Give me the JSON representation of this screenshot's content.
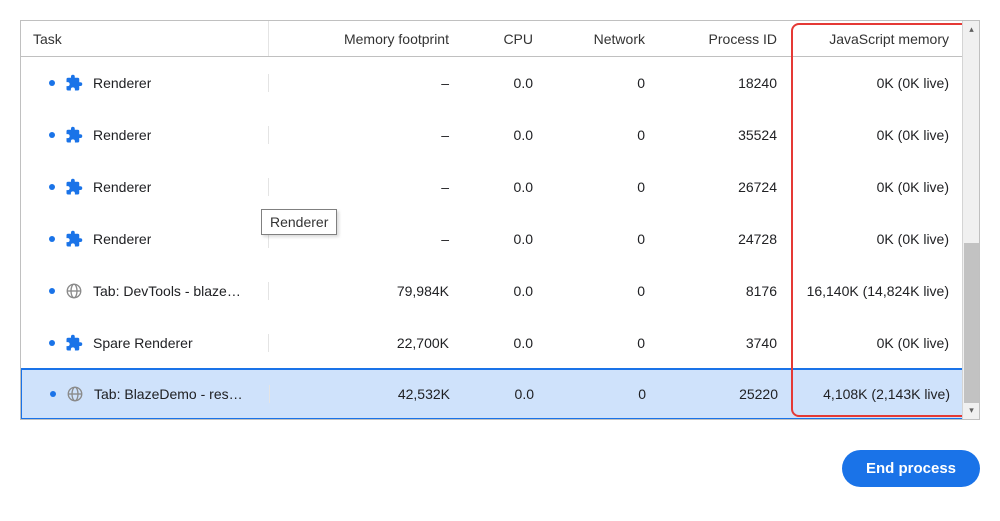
{
  "header": {
    "task": "Task",
    "mem": "Memory footprint",
    "cpu": "CPU",
    "net": "Network",
    "pid": "Process ID",
    "js": "JavaScript memory"
  },
  "tooltip": "Renderer",
  "endButton": "End process",
  "rows": [
    {
      "icon": "ext",
      "name": "Renderer",
      "mem": "–",
      "cpu": "0.0",
      "net": "0",
      "pid": "18240",
      "js": "0K (0K live)"
    },
    {
      "icon": "ext",
      "name": "Renderer",
      "mem": "–",
      "cpu": "0.0",
      "net": "0",
      "pid": "35524",
      "js": "0K (0K live)"
    },
    {
      "icon": "ext",
      "name": "Renderer",
      "mem": "–",
      "cpu": "0.0",
      "net": "0",
      "pid": "26724",
      "js": "0K (0K live)"
    },
    {
      "icon": "ext",
      "name": "Renderer",
      "mem": "–",
      "cpu": "0.0",
      "net": "0",
      "pid": "24728",
      "js": "0K (0K live)"
    },
    {
      "icon": "globe",
      "name": "Tab: DevTools - blaze…",
      "mem": "79,984K",
      "cpu": "0.0",
      "net": "0",
      "pid": "8176",
      "js": "16,140K (14,824K live)"
    },
    {
      "icon": "ext",
      "name": "Spare Renderer",
      "mem": "22,700K",
      "cpu": "0.0",
      "net": "0",
      "pid": "3740",
      "js": "0K (0K live)"
    },
    {
      "icon": "globe",
      "name": "Tab: BlazeDemo - res…",
      "mem": "42,532K",
      "cpu": "0.0",
      "net": "0",
      "pid": "25220",
      "js": "4,108K (2,143K live)",
      "selected": true
    }
  ]
}
